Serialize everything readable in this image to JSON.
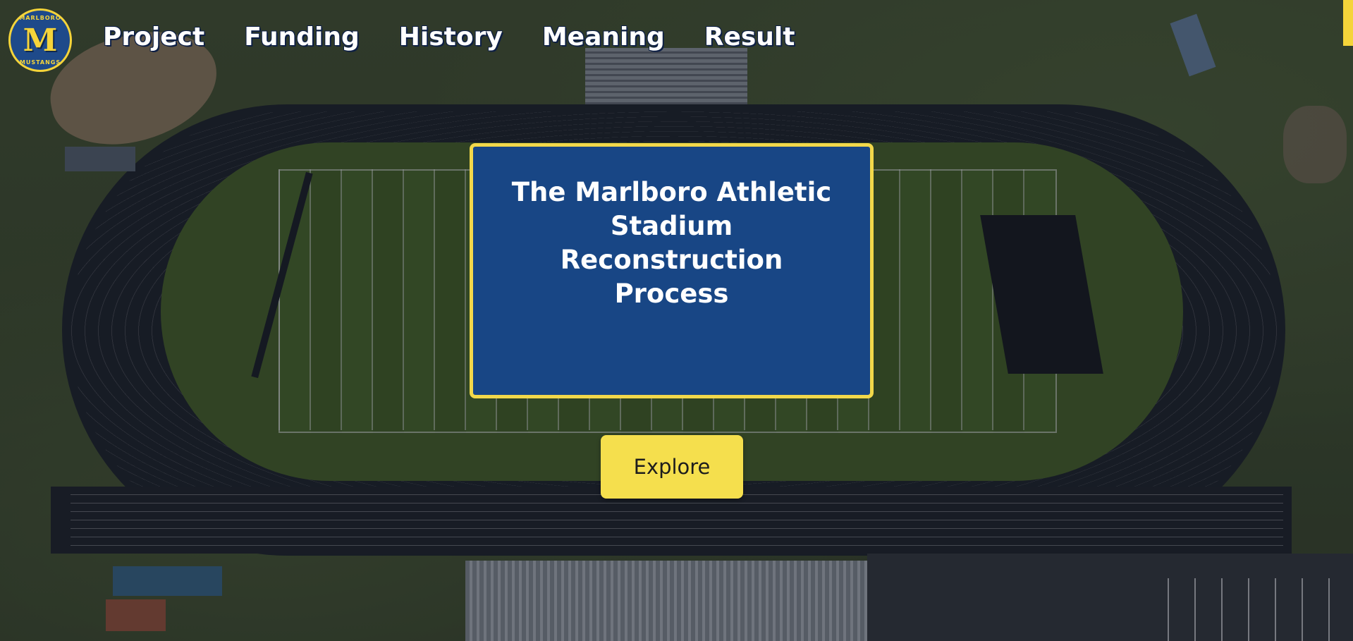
{
  "brand": {
    "logo_letter": "M",
    "logo_top_text": "MARLBORO",
    "logo_bottom_text": "MUSTANGS"
  },
  "nav": {
    "items": [
      {
        "label": "Project"
      },
      {
        "label": "Funding"
      },
      {
        "label": "History"
      },
      {
        "label": "Meaning"
      },
      {
        "label": "Result"
      }
    ]
  },
  "hero": {
    "title": "The Marlboro Athletic Stadium Reconstruction Process",
    "button_label": "Explore"
  },
  "colors": {
    "primary_blue": "#184685",
    "accent_yellow": "#f5df4d",
    "card_border": "#f2d84a"
  }
}
